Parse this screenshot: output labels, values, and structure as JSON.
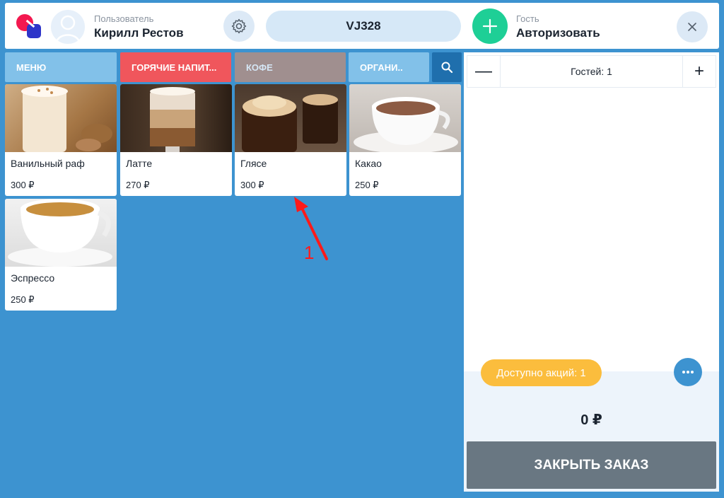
{
  "header": {
    "user_label": "Пользователь",
    "user_name": "Кирилл Рестов",
    "order_code": "VJ328",
    "guest_label": "Гость",
    "guest_action": "Авторизовать"
  },
  "tabs": [
    {
      "label": "МЕНЮ"
    },
    {
      "label": "ГОРЯЧИЕ НАПИТ..."
    },
    {
      "label": "КОФЕ"
    },
    {
      "label": "ОРГАНИ.."
    }
  ],
  "products": [
    {
      "name": "Ванильный раф",
      "price": "300 ₽"
    },
    {
      "name": "Латте",
      "price": "270 ₽"
    },
    {
      "name": "Глясе",
      "price": "300 ₽"
    },
    {
      "name": "Какао",
      "price": "250 ₽"
    },
    {
      "name": "Эспрессо",
      "price": "250 ₽"
    }
  ],
  "order": {
    "guests_label": "Гостей: 1",
    "minus": "—",
    "plus": "+",
    "promo": "Доступно акций: 1",
    "total": "0 ₽",
    "close_label": "ЗАКРЫТЬ ЗАКАЗ"
  },
  "annotation": {
    "number": "1",
    "color": "#ff1a1a"
  },
  "colors": {
    "background": "#3d93d0",
    "tab_menu": "#82c1e9",
    "tab_hot": "#f0565c",
    "tab_coffee": "#a08f8f",
    "add_guest": "#1ecf96",
    "promo": "#fbbd3d",
    "close_order": "#697782"
  }
}
